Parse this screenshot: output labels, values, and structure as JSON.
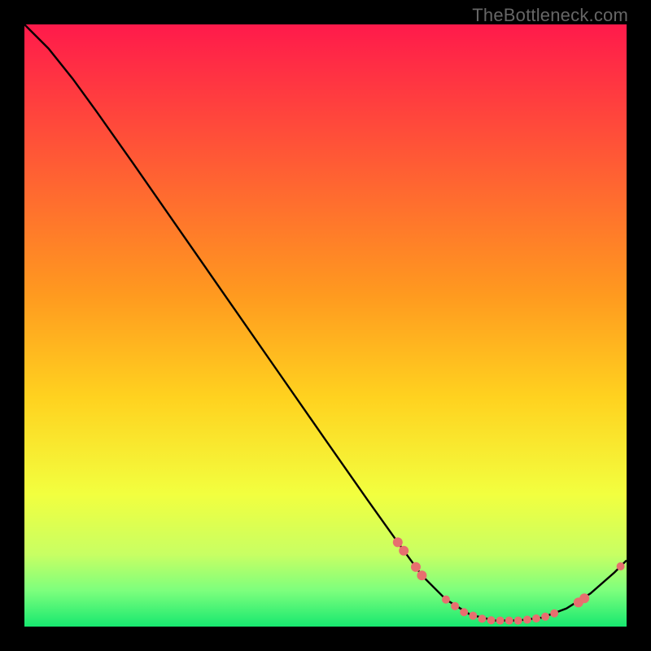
{
  "watermark": "TheBottleneck.com",
  "chart_data": {
    "type": "line",
    "title": "",
    "xlabel": "",
    "ylabel": "",
    "xlim": [
      0,
      100
    ],
    "ylim": [
      0,
      100
    ],
    "grid": false,
    "legend": false,
    "background_gradient_stops": [
      {
        "pct": 0,
        "color": "#ff1a4b"
      },
      {
        "pct": 45,
        "color": "#ff9a1f"
      },
      {
        "pct": 62,
        "color": "#ffd21f"
      },
      {
        "pct": 78,
        "color": "#f2ff3f"
      },
      {
        "pct": 88,
        "color": "#c8ff63"
      },
      {
        "pct": 94,
        "color": "#7dff7d"
      },
      {
        "pct": 100,
        "color": "#17e86f"
      }
    ],
    "curve": [
      {
        "x": 0,
        "y": 100
      },
      {
        "x": 4,
        "y": 96
      },
      {
        "x": 8,
        "y": 91
      },
      {
        "x": 12,
        "y": 85.5
      },
      {
        "x": 18,
        "y": 77
      },
      {
        "x": 26,
        "y": 65.5
      },
      {
        "x": 34,
        "y": 54
      },
      {
        "x": 42,
        "y": 42.5
      },
      {
        "x": 50,
        "y": 31
      },
      {
        "x": 57,
        "y": 21
      },
      {
        "x": 62,
        "y": 14
      },
      {
        "x": 66,
        "y": 8.5
      },
      {
        "x": 70,
        "y": 4.5
      },
      {
        "x": 74,
        "y": 2
      },
      {
        "x": 78,
        "y": 1
      },
      {
        "x": 82,
        "y": 1
      },
      {
        "x": 86,
        "y": 1.5
      },
      {
        "x": 90,
        "y": 3
      },
      {
        "x": 94,
        "y": 5.5
      },
      {
        "x": 98,
        "y": 9
      },
      {
        "x": 100,
        "y": 11
      }
    ],
    "markers": [
      {
        "x": 62,
        "y": 14,
        "r": 6
      },
      {
        "x": 63,
        "y": 12.6,
        "r": 6
      },
      {
        "x": 65,
        "y": 9.9,
        "r": 6
      },
      {
        "x": 66,
        "y": 8.5,
        "r": 6
      },
      {
        "x": 70,
        "y": 4.5,
        "r": 5
      },
      {
        "x": 71.5,
        "y": 3.4,
        "r": 5
      },
      {
        "x": 73,
        "y": 2.4,
        "r": 5
      },
      {
        "x": 74.5,
        "y": 1.8,
        "r": 5
      },
      {
        "x": 76,
        "y": 1.3,
        "r": 5
      },
      {
        "x": 77.5,
        "y": 1.05,
        "r": 5
      },
      {
        "x": 79,
        "y": 1.0,
        "r": 5
      },
      {
        "x": 80.5,
        "y": 1.0,
        "r": 5
      },
      {
        "x": 82,
        "y": 1.0,
        "r": 5
      },
      {
        "x": 83.5,
        "y": 1.15,
        "r": 5
      },
      {
        "x": 85,
        "y": 1.35,
        "r": 5
      },
      {
        "x": 86.5,
        "y": 1.65,
        "r": 5
      },
      {
        "x": 88,
        "y": 2.2,
        "r": 5
      },
      {
        "x": 92,
        "y": 4.0,
        "r": 6
      },
      {
        "x": 93,
        "y": 4.7,
        "r": 6
      },
      {
        "x": 99,
        "y": 10,
        "r": 5
      }
    ],
    "marker_color": "#e76f6f",
    "curve_color": "#000000"
  }
}
